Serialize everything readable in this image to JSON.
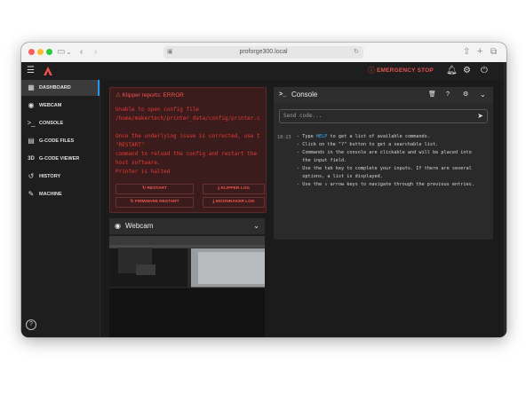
{
  "browser": {
    "url": "proforge300.local"
  },
  "appbar": {
    "emergency_stop": "EMERGENCY STOP"
  },
  "sidebar": {
    "items": [
      {
        "label": "DASHBOARD",
        "icon": "dashboard-icon",
        "active": true
      },
      {
        "label": "WEBCAM",
        "icon": "webcam-icon"
      },
      {
        "label": "CONSOLE",
        "icon": "console-icon"
      },
      {
        "label": "G-CODE FILES",
        "icon": "files-icon"
      },
      {
        "label": "G-CODE VIEWER",
        "icon": "3d-icon",
        "glyph": "3D"
      },
      {
        "label": "HISTORY",
        "icon": "history-icon"
      },
      {
        "label": "MACHINE",
        "icon": "wrench-icon"
      }
    ]
  },
  "error_card": {
    "title": "Klipper reports: ERROR",
    "lines": [
      "Unable to open config file",
      "/home/makertech/printer_data/config/printer.c",
      "",
      "Once the underlying issue is corrected, use t",
      "\"RESTART\"",
      "command to reload the config and restart the",
      "host software.",
      "Printer is halted"
    ],
    "buttons": {
      "restart": "RESTART",
      "klipper_log": "KLIPPER LOG",
      "firmware_restart": "FIRMWARE RESTART",
      "moonraker_log": "MOONRAKER LOG"
    }
  },
  "webcam": {
    "title": "Webcam"
  },
  "console": {
    "title": "Console",
    "input_placeholder": "Send code...",
    "log": {
      "time": "18:23",
      "line1_prefix": "- Type ",
      "line1_keyword": "HELP",
      "line1_suffix": " to get a list of available commands.",
      "lines": [
        "- Click on the \"?\" button to get a searchable list.",
        "- Commands in the console are clickable and will be placed into",
        "  the input field.",
        "- Use the tab key to complete your inputs. If there are several",
        "  options, a list is displayed.",
        "- Use the ⇕ arrow keys to navigate through the previous entries."
      ]
    }
  },
  "colors": {
    "accent": "#2196f3",
    "error": "#ef5350",
    "brand": "#e5534b"
  }
}
